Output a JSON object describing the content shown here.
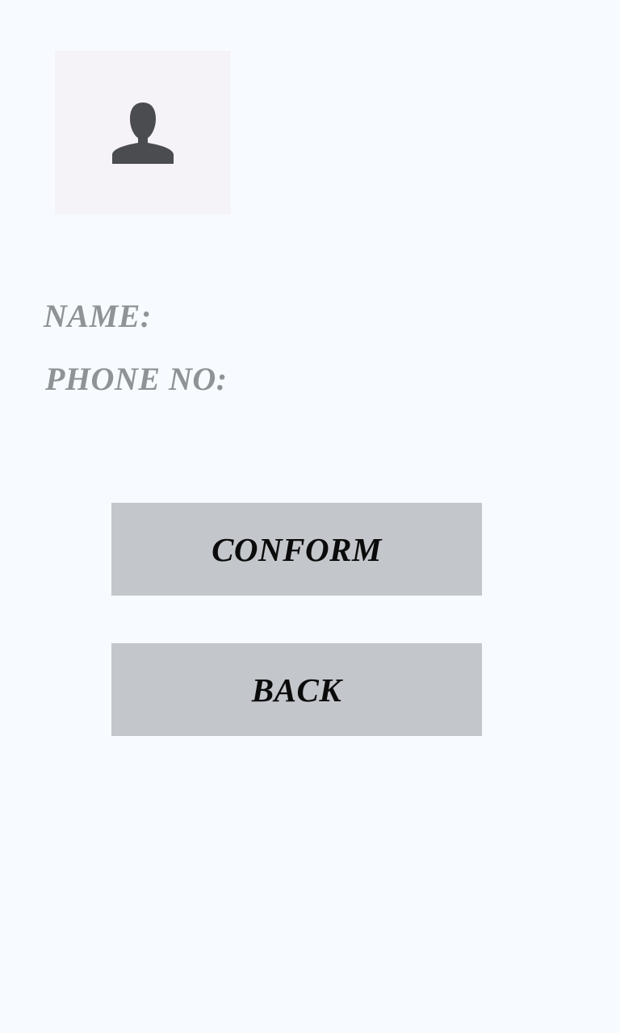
{
  "profile": {
    "avatar_icon": "user-silhouette-icon",
    "icon_color": "#4a4c4f"
  },
  "fields": {
    "name_label": "NAME:",
    "phone_label": "PHONE NO:"
  },
  "actions": {
    "conform_label": "CONFORM",
    "back_label": "BACK"
  },
  "colors": {
    "background": "#f7fbff",
    "avatar_bg": "#f5f3f8",
    "button_bg": "#c3c6cb",
    "label_text": "#8e9396",
    "button_text": "#0b0b0b"
  }
}
